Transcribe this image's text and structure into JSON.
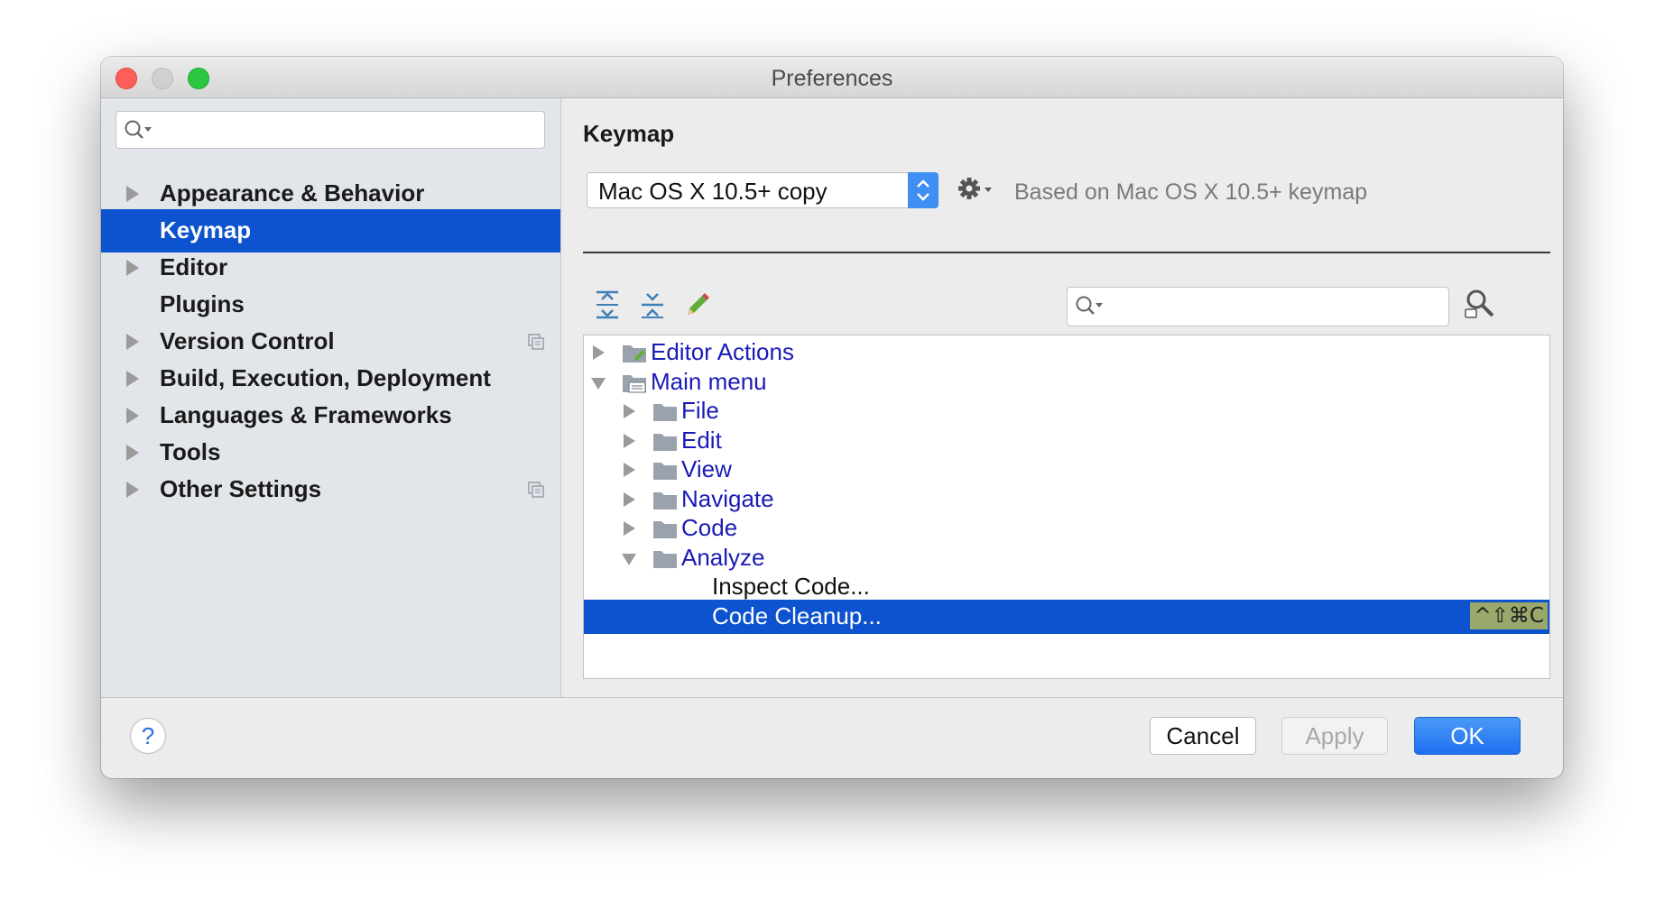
{
  "window": {
    "title": "Preferences"
  },
  "sidebar": {
    "search_placeholder": "",
    "items": [
      {
        "label": "Appearance & Behavior",
        "expandable": true,
        "selected": false,
        "project_level": false
      },
      {
        "label": "Keymap",
        "expandable": false,
        "selected": true,
        "project_level": false
      },
      {
        "label": "Editor",
        "expandable": true,
        "selected": false,
        "project_level": false
      },
      {
        "label": "Plugins",
        "expandable": false,
        "selected": false,
        "project_level": false
      },
      {
        "label": "Version Control",
        "expandable": true,
        "selected": false,
        "project_level": true
      },
      {
        "label": "Build, Execution, Deployment",
        "expandable": true,
        "selected": false,
        "project_level": false
      },
      {
        "label": "Languages & Frameworks",
        "expandable": true,
        "selected": false,
        "project_level": false
      },
      {
        "label": "Tools",
        "expandable": true,
        "selected": false,
        "project_level": false
      },
      {
        "label": "Other Settings",
        "expandable": true,
        "selected": false,
        "project_level": true
      }
    ]
  },
  "keymap": {
    "heading": "Keymap",
    "selected_keymap": "Mac OS X 10.5+ copy",
    "based_on": "Based on Mac OS X 10.5+ keymap",
    "filter_placeholder": ""
  },
  "tree": {
    "rows": [
      {
        "label": "Editor Actions",
        "state": "collapsed",
        "icon": "editor-actions-icon",
        "color": "blue"
      },
      {
        "label": "Main menu",
        "state": "expanded",
        "icon": "main-menu-icon",
        "color": "blue"
      },
      {
        "label": "File",
        "state": "collapsed",
        "icon": "folder-icon",
        "color": "blue"
      },
      {
        "label": "Edit",
        "state": "collapsed",
        "icon": "folder-icon",
        "color": "blue"
      },
      {
        "label": "View",
        "state": "collapsed",
        "icon": "folder-icon",
        "color": "blue"
      },
      {
        "label": "Navigate",
        "state": "collapsed",
        "icon": "folder-icon",
        "color": "blue"
      },
      {
        "label": "Code",
        "state": "collapsed",
        "icon": "folder-icon",
        "color": "blue"
      },
      {
        "label": "Analyze",
        "state": "expanded",
        "icon": "folder-icon",
        "color": "blue"
      },
      {
        "label": "Inspect Code...",
        "state": "leaf",
        "icon": "",
        "color": "black"
      },
      {
        "label": "Code Cleanup...",
        "state": "leaf",
        "icon": "",
        "color": "black",
        "selected": true,
        "shortcut": "^⇧⌘C"
      }
    ]
  },
  "footer": {
    "help_label": "?",
    "cancel_label": "Cancel",
    "apply_label": "Apply",
    "ok_label": "OK"
  },
  "colors": {
    "selection": "#0d52cf",
    "link_blue": "#1a1ab8",
    "ok_button": "#2a7df4",
    "shortcut_badge": "#9ba86b"
  }
}
